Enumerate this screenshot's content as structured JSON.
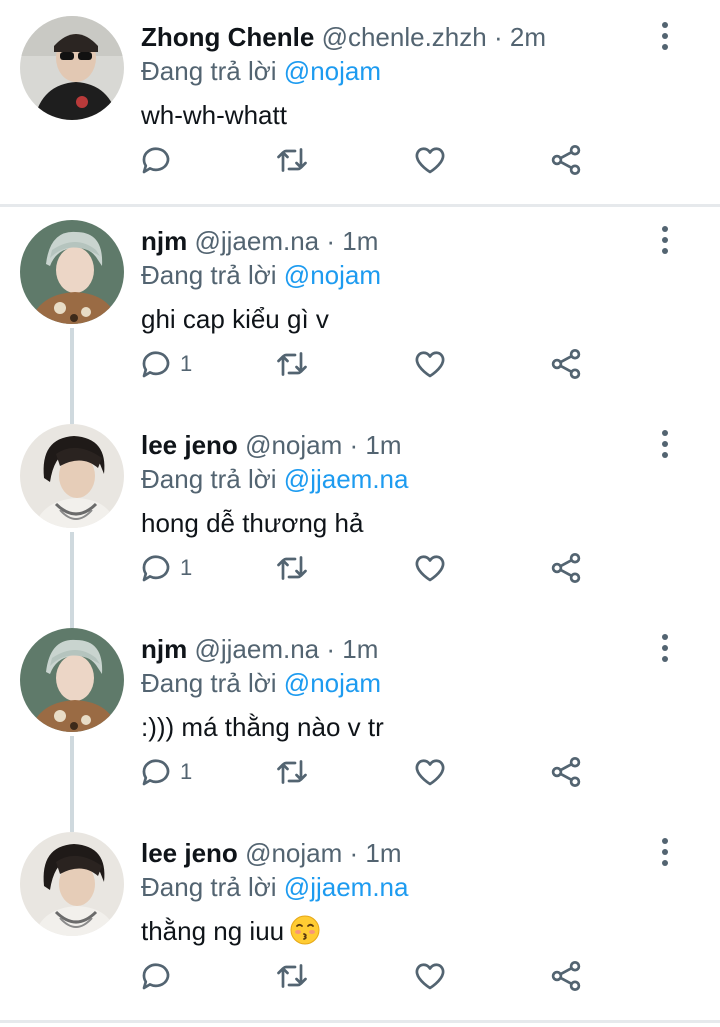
{
  "reply_prefix": "Đang trả lời",
  "tweets": [
    {
      "name": "Zhong Chenle",
      "handle": "@chenle.zhzh",
      "separator": "·",
      "time": "2m",
      "reply_to": "@nojam",
      "text": "wh-wh-whatt",
      "reply_count": "",
      "avatar": "avatar-chenle"
    },
    {
      "name": "njm",
      "handle": "@jjaem.na",
      "separator": "·",
      "time": "1m",
      "reply_to": "@nojam",
      "text": "ghi cap kiểu gì v",
      "reply_count": "1",
      "avatar": "avatar-njm"
    },
    {
      "name": "lee jeno",
      "handle": "@nojam",
      "separator": "·",
      "time": "1m",
      "reply_to": "@jjaem.na",
      "text": "hong dễ thương hả",
      "reply_count": "1",
      "avatar": "avatar-jeno"
    },
    {
      "name": "njm",
      "handle": "@jjaem.na",
      "separator": "·",
      "time": "1m",
      "reply_to": "@nojam",
      "text": ":))) má thằng nào v tr",
      "reply_count": "1",
      "avatar": "avatar-njm"
    },
    {
      "name": "lee jeno",
      "handle": "@nojam",
      "separator": "·",
      "time": "1m",
      "reply_to": "@jjaem.na",
      "text": "thằng ng iuu",
      "text_emoji": "kissing-face-emoji",
      "reply_count": "",
      "avatar": "avatar-jeno"
    }
  ],
  "icons": {
    "reply": "reply-icon",
    "retweet": "retweet-icon",
    "like": "heart-icon",
    "share": "share-icon",
    "more": "more-vertical-icon"
  },
  "colors": {
    "text": "#0f1419",
    "secondary": "#536471",
    "link": "#1d9bf0",
    "divider": "#e6e9ec",
    "thread_line": "#cfd9de"
  }
}
